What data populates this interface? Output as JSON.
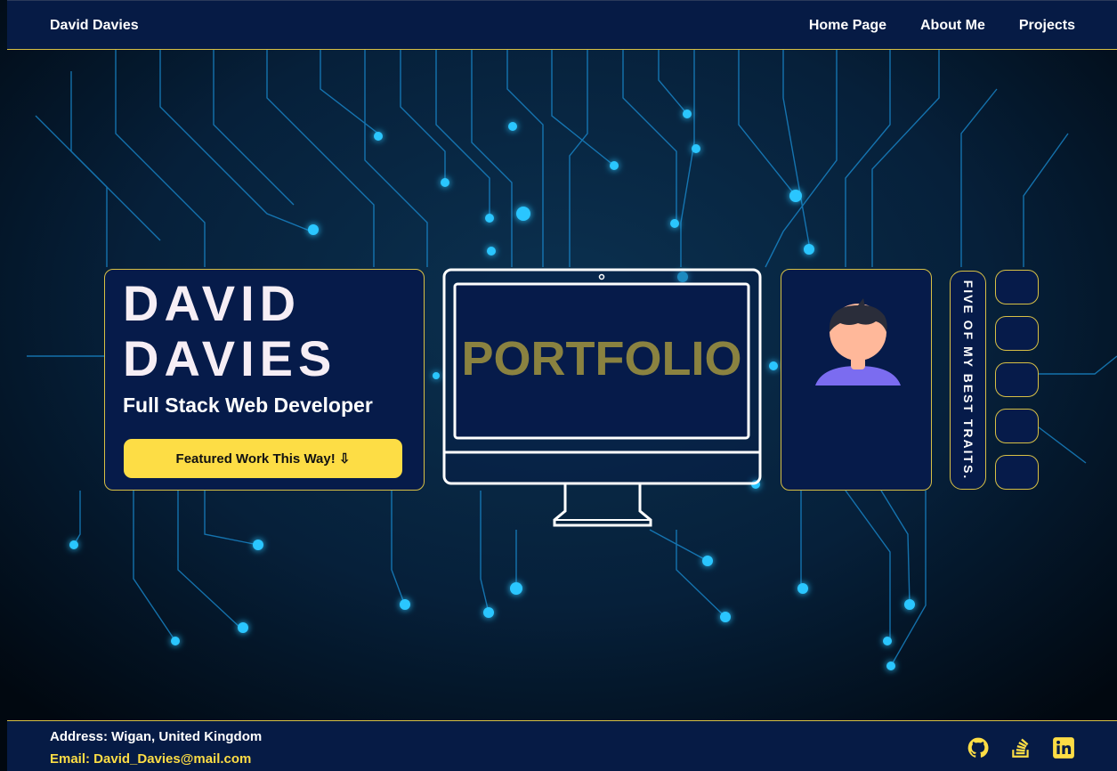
{
  "navbar": {
    "brand": "David Davies",
    "links": [
      "Home Page",
      "About Me",
      "Projects"
    ]
  },
  "hero": {
    "first_name": "DAVID",
    "last_name": "DAVIES",
    "role": "Full Stack Web Developer",
    "cta_label": "Featured Work This Way! ⇩",
    "monitor_text": "PORTFOLIO",
    "traits_label": "FIVE OF MY BEST TRAITS."
  },
  "footer": {
    "address": "Address: Wigan, United Kingdom",
    "email": "Email: David_Davies@mail.com",
    "social_icons": [
      "github-icon",
      "stackoverflow-icon",
      "linkedin-icon"
    ]
  },
  "colors": {
    "accent": "#fddd45",
    "navy": "#061b45",
    "background": "#020c17",
    "circuit": "#1aa8ff"
  }
}
